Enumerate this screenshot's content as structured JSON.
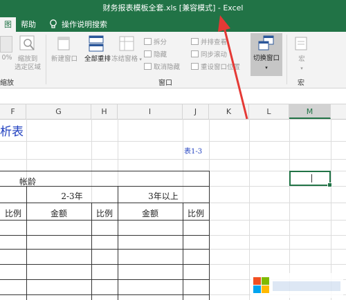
{
  "window": {
    "title": "财务报表模板全套.xls [兼容模式] - Excel"
  },
  "tabs": [
    {
      "label": "图",
      "active": true
    },
    {
      "label": "帮助",
      "active": false
    },
    {
      "label": "操作说明搜索",
      "active": false
    }
  ],
  "ribbon": {
    "zoom_pct": "0%",
    "zoom_selection": [
      "缩放到",
      "选定区域"
    ],
    "new_window": "新建窗口",
    "arrange_all": "全部重排",
    "freeze_panes": "冻结窗格",
    "split": "拆分",
    "hide": "隐藏",
    "unhide": "取消隐藏",
    "side_by_side": "并排查看",
    "sync_scroll": "同步滚动",
    "reset_position": "重设窗口位置",
    "switch_windows": "切换窗口",
    "macros": "宏",
    "group_zoom": "缩放",
    "group_window": "窗口",
    "group_macros": "宏"
  },
  "columns": [
    "F",
    "G",
    "H",
    "I",
    "J",
    "K",
    "L",
    "M"
  ],
  "selected_column": "M",
  "sheet": {
    "title_fragment": "析表",
    "table_ref": "表1-3",
    "header_age": "帐龄",
    "bucket_2_3": "2-3年",
    "bucket_3plus": "3年以上",
    "col_ratio": "比例",
    "col_amount": "金额"
  },
  "colors": {
    "excel_green": "#217346",
    "link_blue": "#1f3fbf",
    "arrow_red": "#e53935"
  }
}
